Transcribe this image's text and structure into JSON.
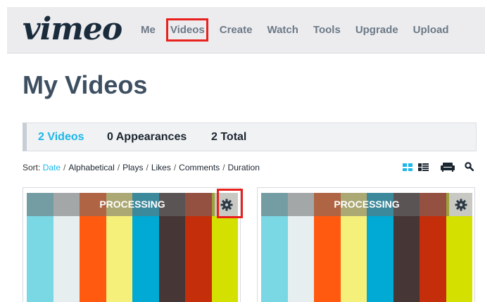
{
  "header": {
    "logo": "vimeo",
    "nav": [
      "Me",
      "Videos",
      "Create",
      "Watch",
      "Tools",
      "Upgrade",
      "Upload"
    ]
  },
  "page_title": "My Videos",
  "tabs": [
    {
      "label": "2 Videos",
      "active": true
    },
    {
      "label": "0 Appearances",
      "active": false
    },
    {
      "label": "2 Total",
      "active": false
    }
  ],
  "sort": {
    "label": "Sort:",
    "options": [
      "Date",
      "Alphabetical",
      "Plays",
      "Likes",
      "Comments",
      "Duration"
    ],
    "active": "Date"
  },
  "view_icons": [
    "grid-view-icon",
    "list-view-icon",
    "couch-mode-icon",
    "search-icon"
  ],
  "videos": [
    {
      "status": "PROCESSING",
      "settings_icon": "gear-icon"
    },
    {
      "status": "PROCESSING",
      "settings_icon": "gear-icon"
    }
  ],
  "colors": {
    "accent": "#1ab7ea",
    "highlight": "#e8211d",
    "color_bars": [
      "#7ad7e4",
      "#e6eef0",
      "#ff5a10",
      "#f5f07a",
      "#00aad4",
      "#463636",
      "#c42e0a",
      "#d4e000"
    ]
  }
}
